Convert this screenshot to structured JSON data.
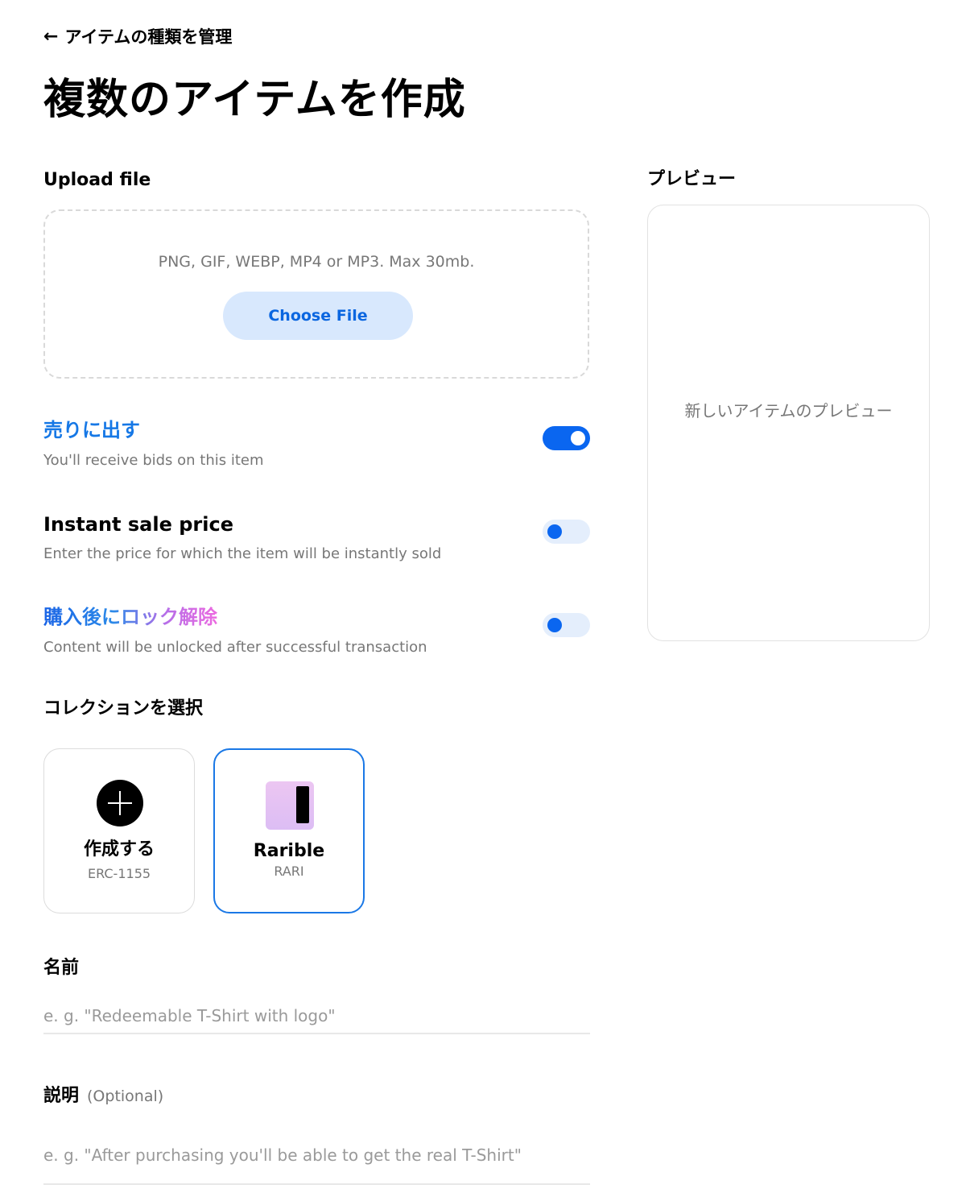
{
  "header": {
    "back_arrow": "←",
    "back_label": "アイテムの種類を管理",
    "title": "複数のアイテムを作成"
  },
  "upload": {
    "heading": "Upload file",
    "hint": "PNG, GIF, WEBP, MP4 or MP3. Max 30mb.",
    "button_label": "Choose File"
  },
  "toggles": [
    {
      "title": "売りに出す",
      "description": "You'll receive bids on this item",
      "on": true
    },
    {
      "title": "Instant sale price",
      "description": "Enter the price for which the item will be instantly sold",
      "on": false
    },
    {
      "title": "購入後にロック解除",
      "description": "Content will be unlocked after successful transaction",
      "on": false
    }
  ],
  "collection": {
    "heading": "コレクションを選択",
    "cards": [
      {
        "name": "作成する",
        "sub": "ERC-1155",
        "selected": false
      },
      {
        "name": "Rarible",
        "sub": "RARI",
        "selected": true
      }
    ]
  },
  "fields": {
    "name_label": "名前",
    "name_placeholder": "e. g. \"Redeemable T-Shirt with logo\"",
    "description_label": "説明",
    "description_optional": "(Optional)",
    "description_placeholder": "e. g. \"After purchasing you'll be able to get the real T-Shirt\""
  },
  "preview": {
    "heading": "プレビュー",
    "placeholder_text": "新しいアイテムのプレビュー"
  },
  "colors": {
    "accent_blue": "#0a66f0",
    "button_bg": "#d8e8fd",
    "muted_text": "#777777"
  }
}
